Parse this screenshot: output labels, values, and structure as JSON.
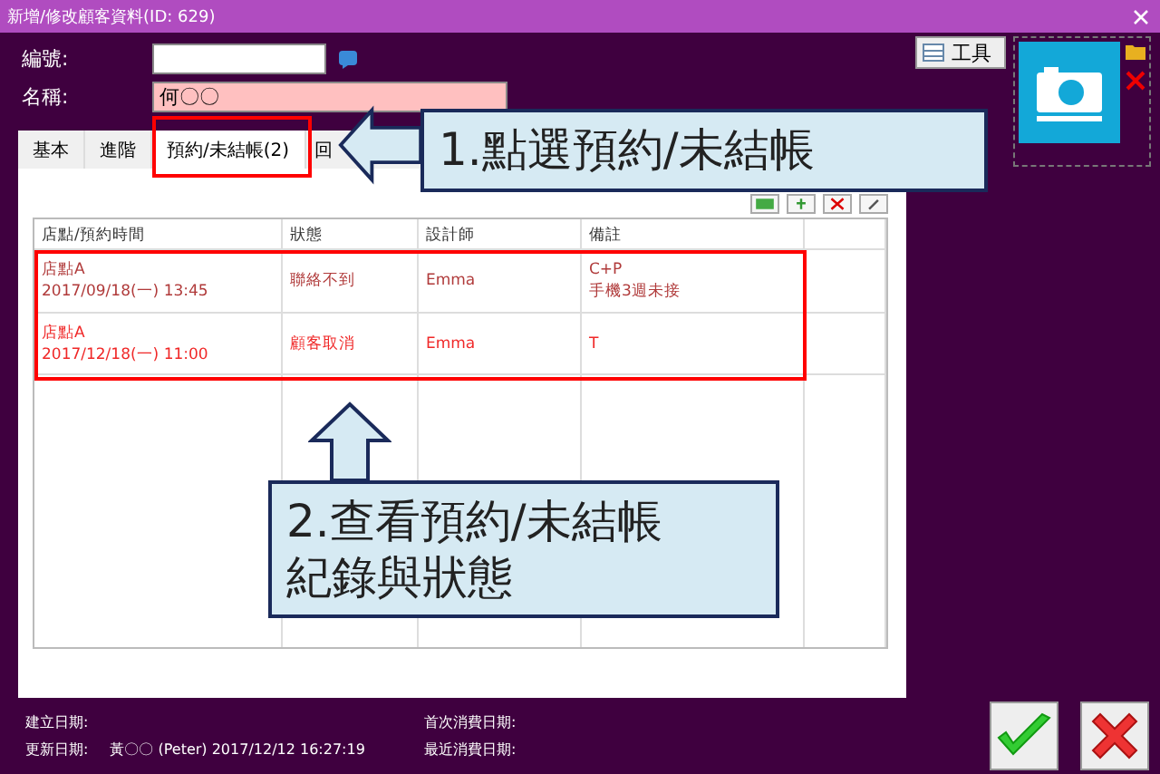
{
  "window": {
    "title": "新增/修改顧客資料(ID: 629)"
  },
  "fields": [
    {
      "label": "編號:",
      "highlight": false
    },
    {
      "label": "名稱:",
      "value": "何〇〇",
      "highlight": true
    }
  ],
  "tools_button": "工具",
  "tabs": [
    {
      "label": "基本",
      "selected": false
    },
    {
      "label": "進階",
      "selected": false
    },
    {
      "label": "預約/未結帳(2)",
      "selected": true
    },
    {
      "label": "回",
      "selected": false
    }
  ],
  "table": {
    "columns": [
      "店點/預約時間",
      "狀態",
      "設計師",
      "備註"
    ],
    "rows": [
      {
        "color": "#b03a3a",
        "cells": [
          [
            "店點A",
            "2017/09/18(一) 13:45"
          ],
          [
            "聯絡不到"
          ],
          [
            "Emma"
          ],
          [
            "C+P",
            "手機3週未接"
          ]
        ]
      },
      {
        "color": "#f02828",
        "cells": [
          [
            "店點A",
            "2017/12/18(一) 11:00"
          ],
          [
            "顧客取消"
          ],
          [
            "Emma"
          ],
          [
            "T"
          ]
        ]
      }
    ]
  },
  "callouts": [
    {
      "lines": [
        "1.點選預約/未結帳"
      ]
    },
    {
      "lines": [
        "2.查看預約/未結帳",
        "紀錄與狀態"
      ]
    }
  ],
  "footer": [
    {
      "label": "建立日期:"
    },
    {
      "label": "更新日期:",
      "value": "黃〇〇 (Peter) 2017/12/12 16:27:19"
    },
    {
      "label": "首次消費日期:"
    },
    {
      "label": "最近消費日期:"
    }
  ]
}
